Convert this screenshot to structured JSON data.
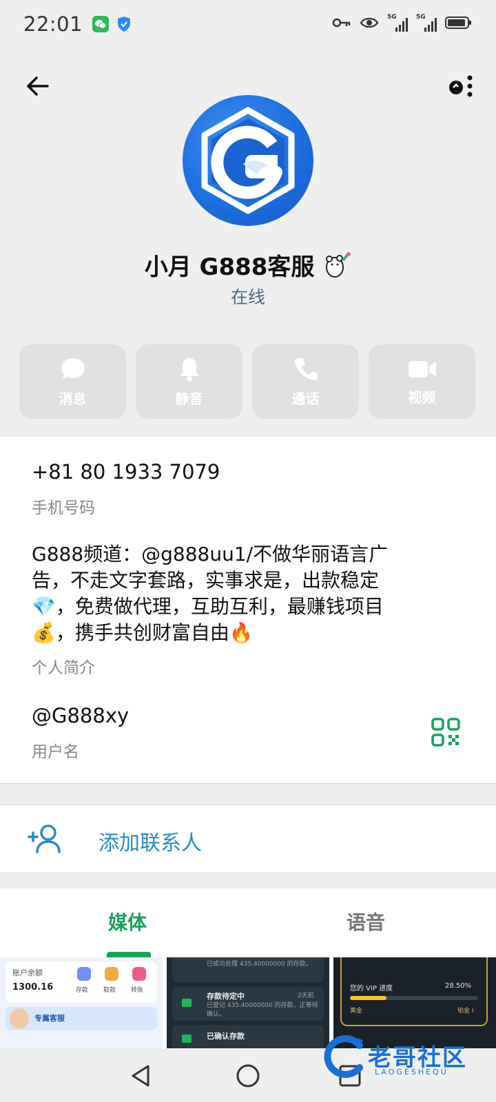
{
  "status_bar": {
    "time": "22:01",
    "network_left": "5G",
    "network_right": "5G"
  },
  "profile": {
    "name": "小月 G888客服",
    "status": "在线",
    "avatar_letter": "G"
  },
  "actions": [
    {
      "label": "消息",
      "icon": "message-icon"
    },
    {
      "label": "静音",
      "icon": "bell-icon"
    },
    {
      "label": "通话",
      "icon": "phone-icon"
    },
    {
      "label": "视频",
      "icon": "video-icon"
    }
  ],
  "info": {
    "phone": "+81 80 1933 7079",
    "phone_label": "手机号码",
    "bio_line1": "G888频道：@g888uu1/不做华丽语言广",
    "bio_line2": "告，不走文字套路，实事求是，出款稳定",
    "bio_line3": "💎，免费做代理，互助互利，最赚钱项目",
    "bio_line4": "💰，携手共创财富自由🔥",
    "bio_label": "个人简介",
    "username": "@G888xy",
    "username_label": "用户名"
  },
  "add_contact": {
    "label": "添加联系人"
  },
  "tabs": {
    "media": "媒体",
    "voice": "语音"
  },
  "thumbs": {
    "t1_balance_label": "账户余额",
    "t1_balance": "1300.16",
    "t1_btn1": "存款",
    "t1_btn2": "取款",
    "t1_btn3": "转账",
    "t1_service": "专属客服",
    "t2_row1": "已成功处理 435.40000000 的存款。",
    "t2_row2_title": "存款待定中",
    "t2_row2_time": "2天前",
    "t2_row2_body": "已登记 435.40000000 的存款，正等待确认。",
    "t2_row3_title": "已确认存款",
    "t3_vip": "您的 VIP 进度",
    "t3_percent": "28.50%",
    "t3_left": "黄金",
    "t3_right": "铂金 I"
  },
  "watermark": {
    "text": "老哥社区",
    "sub": "LAOGESHEQU"
  },
  "colors": {
    "accent_green": "#19a35a",
    "link_blue": "#2a8bc4",
    "status_blue": "#4c6a86"
  }
}
